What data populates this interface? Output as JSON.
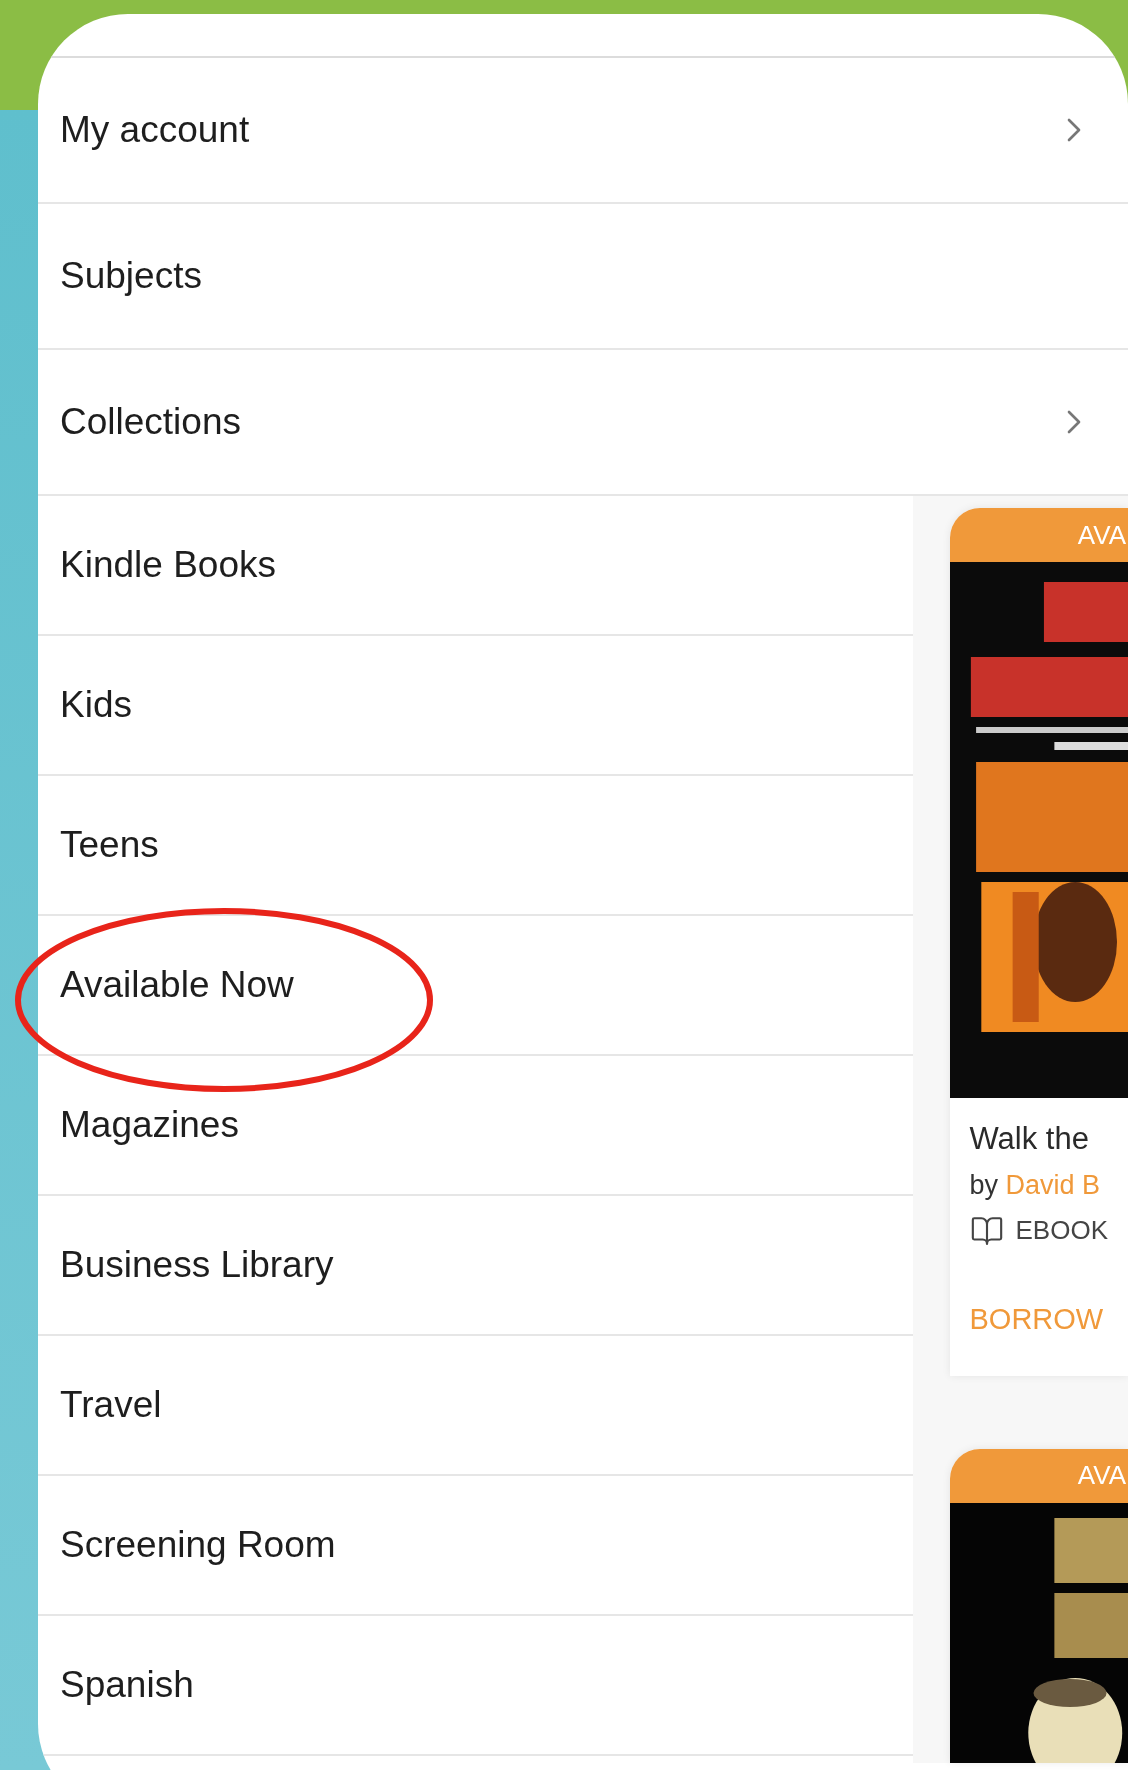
{
  "menu": {
    "items": [
      {
        "label": "My account",
        "has_submenu": true
      },
      {
        "label": "Subjects",
        "has_submenu": false
      },
      {
        "label": "Collections",
        "has_submenu": true
      },
      {
        "label": "Kindle Books",
        "has_submenu": false
      },
      {
        "label": "Kids",
        "has_submenu": false
      },
      {
        "label": "Teens",
        "has_submenu": false
      },
      {
        "label": "Available Now",
        "has_submenu": false
      },
      {
        "label": "Magazines",
        "has_submenu": false
      },
      {
        "label": "Business Library",
        "has_submenu": false
      },
      {
        "label": "Travel",
        "has_submenu": false
      },
      {
        "label": "Screening Room",
        "has_submenu": false
      },
      {
        "label": "Spanish",
        "has_submenu": false
      }
    ]
  },
  "cards": [
    {
      "badge": "AVA",
      "title": "Walk the",
      "by": "by",
      "author": "David B",
      "format": "EBOOK",
      "action": "BORROW"
    },
    {
      "badge": "AVA"
    }
  ]
}
